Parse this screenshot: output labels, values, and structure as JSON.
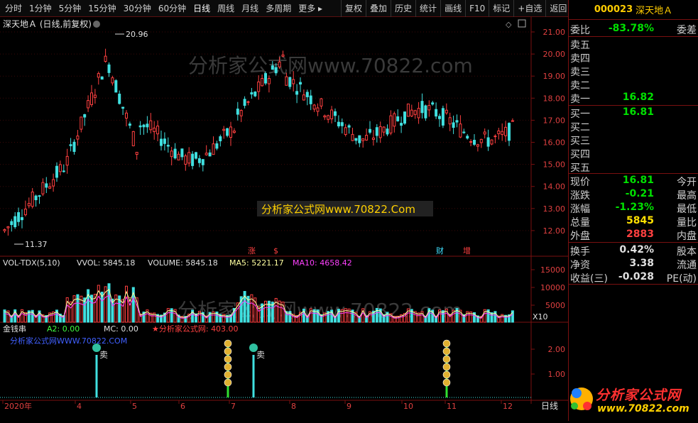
{
  "toolbar": {
    "left": [
      "分时",
      "1分钟",
      "5分钟",
      "15分钟",
      "30分钟",
      "60分钟",
      "日线",
      "周线",
      "月线",
      "多周期",
      "更多 ▸"
    ],
    "right": [
      "复权",
      "叠加",
      "历史",
      "统计",
      "画线",
      "F10",
      "标记",
      "+自选",
      "返回"
    ]
  },
  "header": {
    "code": "000023",
    "name": "深天地Ａ"
  },
  "main": {
    "title": "深天地Ａ (日线,前复权)",
    "price_labels": [
      "21.00",
      "20.00",
      "19.00",
      "18.00",
      "17.00",
      "16.00",
      "15.00",
      "14.00",
      "13.00",
      "12.00"
    ],
    "high_mark": "20.96",
    "low_mark": "11.37",
    "watermark1": "分析家公式网www.70822.com",
    "watermark2": "分析家公式网www.70822.Com",
    "events": [
      "涨",
      "$",
      "财",
      "增"
    ]
  },
  "volume": {
    "label": "VOL-TDX(5,10)",
    "vvol": "VVOL: 5845.18",
    "volume": "VOLUME: 5845.18",
    "ma5": "MA5: 5221.17",
    "ma10": "MA10: 4658.42",
    "scale": [
      "15000",
      "10000",
      "5000"
    ],
    "unit": "X10",
    "watermark": "分析家公式网www.70822.com"
  },
  "indicator": {
    "name": "金钱串",
    "a2": "A2: 0.00",
    "mc": "MC: 0.00",
    "star": "★分析家公式网: 403.00",
    "site": "分析家公式网WWW.70822.COM",
    "sell": "卖",
    "scale": [
      "2.00",
      "1.00"
    ]
  },
  "xaxis": {
    "labels": [
      "2020年",
      "4",
      "5",
      "6",
      "7",
      "8",
      "9",
      "10",
      "11",
      "12"
    ],
    "bottom_right": "日线"
  },
  "quote": {
    "weibi": {
      "label": "委比",
      "value": "-83.78%",
      "label2": "委差"
    },
    "asks": [
      "卖五",
      "卖四",
      "卖三",
      "卖二",
      "卖一"
    ],
    "ask1_price": "16.82",
    "bids": [
      "买一",
      "买二",
      "买三",
      "买四",
      "买五"
    ],
    "bid1_price": "16.81",
    "stats": [
      {
        "l": "现价",
        "v": "16.81",
        "l2": "今开",
        "c": "green"
      },
      {
        "l": "涨跌",
        "v": "-0.21",
        "l2": "最高",
        "c": "green"
      },
      {
        "l": "涨幅",
        "v": "-1.23%",
        "l2": "最低",
        "c": "green"
      },
      {
        "l": "总量",
        "v": "5845",
        "l2": "量比",
        "c": "yellow"
      },
      {
        "l": "外盘",
        "v": "2883",
        "l2": "内盘",
        "c": "red"
      }
    ],
    "stats2": [
      {
        "l": "换手",
        "v": "0.42%",
        "l2": "股本"
      },
      {
        "l": "净资",
        "v": "3.38",
        "l2": "流通"
      },
      {
        "l": "收益(三)",
        "v": "-0.028",
        "l2": "PE(动)"
      }
    ]
  },
  "logo": {
    "title": "分析家公式网",
    "url": "www.70822.com"
  },
  "colors": {
    "up": "#ff4040",
    "down": "#40e0e0",
    "ma5": "#ffffa0",
    "ma10": "#ff40ff",
    "grid": "#7a1010"
  }
}
